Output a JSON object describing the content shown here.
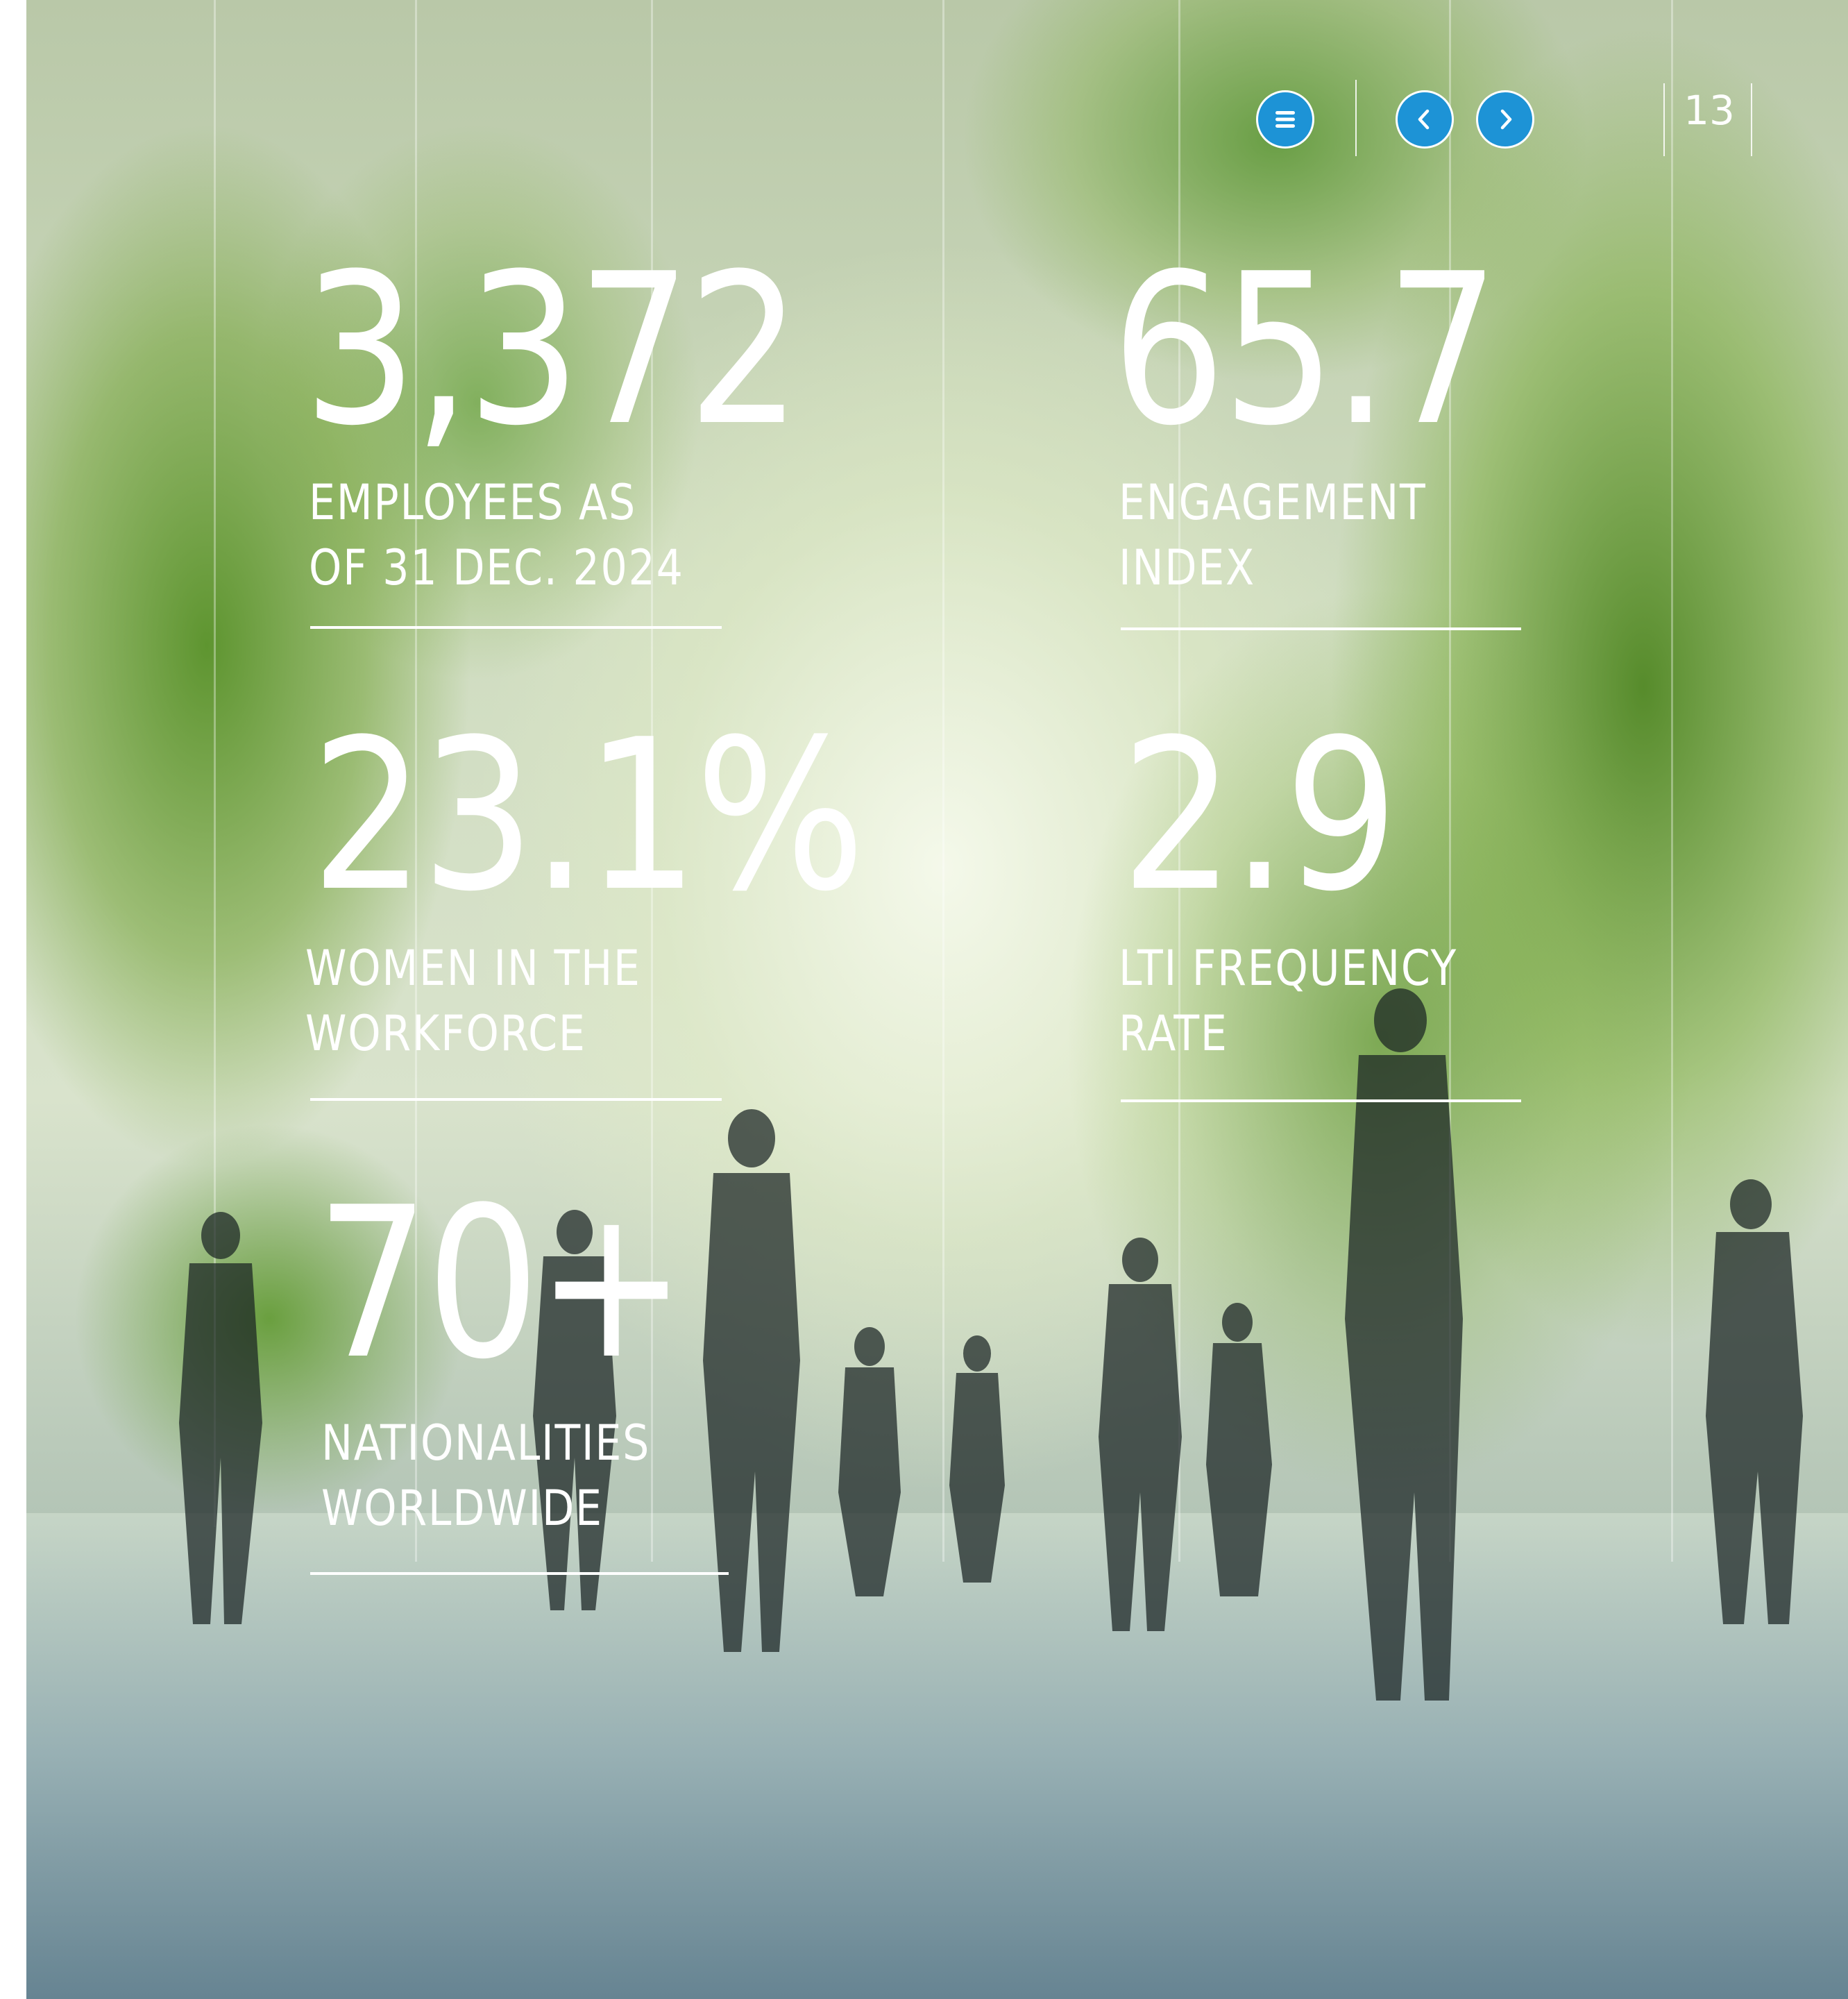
{
  "navigation": {
    "menu_icon": "menu-icon",
    "prev_icon": "chevron-left-icon",
    "next_icon": "chevron-right-icon",
    "page_number": "13",
    "button_color": "#1d93d6"
  },
  "stats": [
    {
      "value": "3,372",
      "label": "EMPLOYEES AS\n OF 31 DEC. 2024"
    },
    {
      "value": "65.7",
      "label": "ENGAGEMENT\nINDEX"
    },
    {
      "value": "23.1%",
      "label": "WOMEN IN THE\nWORKFORCE"
    },
    {
      "value": "2.9",
      "label": "LTI FREQUENCY\nRATE"
    },
    {
      "value": "70+",
      "label": "NATIONALITIES\nWORLDWIDE"
    }
  ]
}
